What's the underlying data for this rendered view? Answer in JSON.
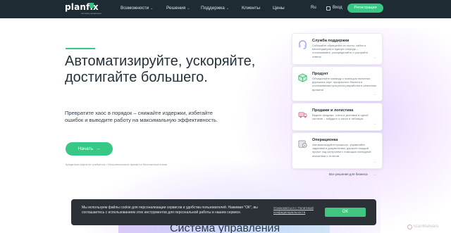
{
  "header": {
    "logo": "planfix",
    "logo_sub": "система управления",
    "nav": [
      {
        "label": "Возможности",
        "has_menu": true
      },
      {
        "label": "Решения",
        "has_menu": true
      },
      {
        "label": "Поддержка",
        "has_menu": true
      },
      {
        "label": "Клиенты",
        "has_menu": false
      },
      {
        "label": "Цены",
        "has_menu": false
      }
    ],
    "lang": "Ru",
    "login": "Вход",
    "register": "Регистрация"
  },
  "hero": {
    "title": "Автоматизируйте, ускоряйте, достигайте большего.",
    "text": "Превратите хаос в порядок – снижайте издержки, избегайте ошибок и выводите работу на максимальную эффективность.",
    "start_button": "Начать",
    "note": "Кредитная карта не требуется • Неограниченное время на бесплатном плане"
  },
  "cards": [
    {
      "title": "Служба поддержки",
      "desc": "Собирайте обращения из почты, сайта и мессенджеров в единую очередь – отслеживайте, распределяйте и ускоряйте ответы",
      "icon": "headset-icon",
      "color": "#7d8fe6"
    },
    {
      "title": "Продукт",
      "desc": "Объединяйте команду с помощью понятных дорожных карт, прозрачного бэклога и отслеживания прогресса разработки в реальном времени",
      "icon": "cube-icon",
      "color": "#3bbd72"
    },
    {
      "title": "Продажи и логистика",
      "desc": "Ведите продажи, счета и доставки в одной системе – забудьте о хаосе в таблицах",
      "icon": "delivery-icon",
      "color": "#e2678f"
    },
    {
      "title": "Операционка",
      "desc": "Автоматизируйте процессы, управляйте задачами и документами, держите каждый проект под контролем с помощью наглядной аналитики и отчетов",
      "icon": "gear-icon",
      "color": "#8a8f98"
    }
  ],
  "all_solutions": "Все решения для бизнеса",
  "bottom_title": "Система управления",
  "cookie": {
    "text": "Мы используем файлы cookie для персонализации сервисов и удобства пользователей. Нажимая \"ОК\", вы соглашаетесь с использованием этих инструментов для персональной работы в нашем сервисе.",
    "link": "Ознакомиться с Политикой конфиденциальности",
    "ok": "OK"
  },
  "watermark": "ScanMalware"
}
